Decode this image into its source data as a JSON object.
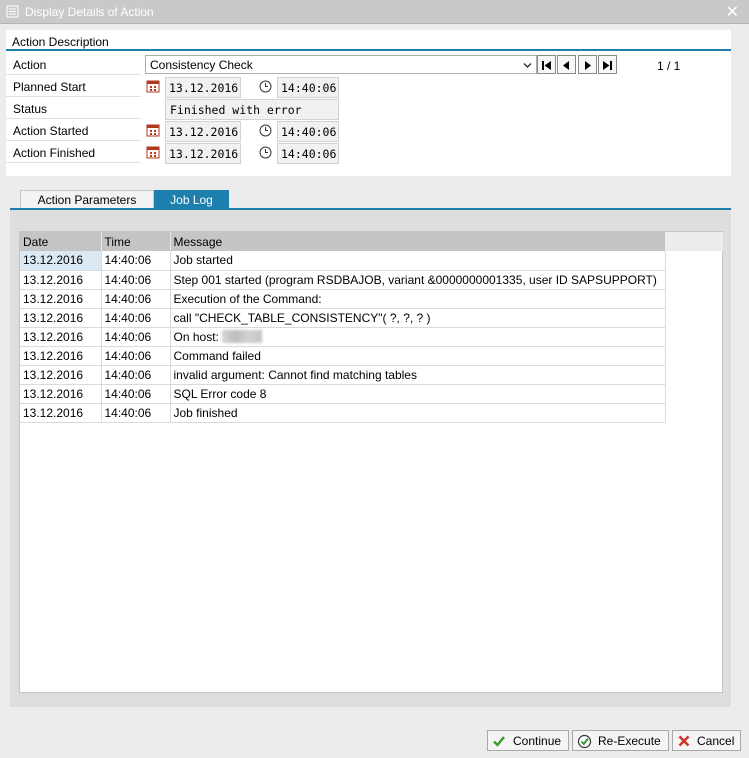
{
  "window": {
    "title": "Display Details of Action"
  },
  "header": {
    "section_title": "Action Description",
    "action_label": "Action",
    "action_value": "Consistency Check",
    "page_indicator": "1 / 1",
    "planned_start_label": "Planned Start",
    "planned_start_date": "13.12.2016",
    "planned_start_time": "14:40:06",
    "status_label": "Status",
    "status_value": "Finished with error",
    "action_started_label": "Action Started",
    "action_started_date": "13.12.2016",
    "action_started_time": "14:40:06",
    "action_finished_label": "Action Finished",
    "action_finished_date": "13.12.2016",
    "action_finished_time": "14:40:06"
  },
  "tabs": [
    {
      "label": "Action Parameters",
      "active": false
    },
    {
      "label": "Job Log",
      "active": true
    }
  ],
  "log": {
    "columns": [
      "Date",
      "Time",
      "Message"
    ],
    "rows": [
      {
        "date": "13.12.2016",
        "time": "14:40:06",
        "message": "Job started"
      },
      {
        "date": "13.12.2016",
        "time": "14:40:06",
        "message": "Step 001 started (program RSDBAJOB, variant &0000000001335, user ID SAPSUPPORT)"
      },
      {
        "date": "13.12.2016",
        "time": "14:40:06",
        "message": "Execution of the Command:"
      },
      {
        "date": "13.12.2016",
        "time": "14:40:06",
        "message": "call \"CHECK_TABLE_CONSISTENCY\"( ?, ?, ? )"
      },
      {
        "date": "13.12.2016",
        "time": "14:40:06",
        "message": "On host:"
      },
      {
        "date": "13.12.2016",
        "time": "14:40:06",
        "message": "Command failed"
      },
      {
        "date": "13.12.2016",
        "time": "14:40:06",
        "message": "invalid argument: Cannot find matching tables"
      },
      {
        "date": "13.12.2016",
        "time": "14:40:06",
        "message": "SQL Error code 8"
      },
      {
        "date": "13.12.2016",
        "time": "14:40:06",
        "message": "Job finished"
      }
    ]
  },
  "footer": {
    "continue_label": "Continue",
    "reexecute_label": "Re-Execute",
    "cancel_label": "Cancel"
  },
  "colors": {
    "accent": "#1d7fad",
    "titlebar": "#c9c9c9",
    "cancel": "#d0342c",
    "continue": "#3b9a2f"
  },
  "icons": [
    "window-icon",
    "close-icon",
    "chevron-down-icon",
    "first-page-icon",
    "prev-page-icon",
    "next-page-icon",
    "last-page-icon",
    "calendar-icon",
    "clock-icon",
    "checkmark-icon",
    "reexecute-icon",
    "cancel-x-icon"
  ]
}
